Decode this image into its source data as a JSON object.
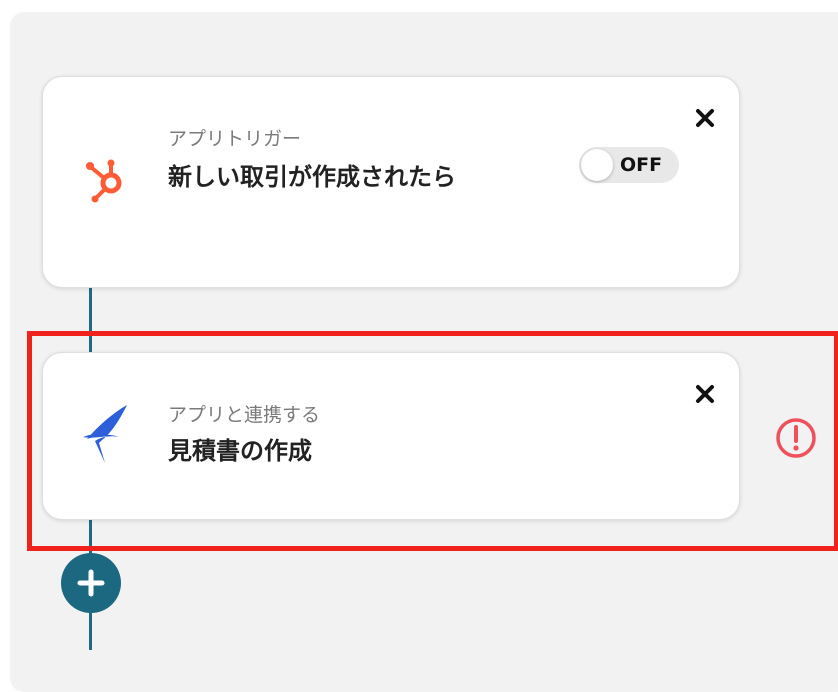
{
  "flow": {
    "trigger": {
      "subtitle": "アプリトリガー",
      "title": "新しい取引が作成されたら",
      "toggle_label": "OFF",
      "app_icon": "hubspot-icon",
      "accent": "#ff5c35"
    },
    "action": {
      "subtitle": "アプリと連携する",
      "title": "見積書の作成",
      "app_icon": "swallow-bird-icon",
      "accent": "#2d5fd8"
    },
    "add_step_icon": "plus-icon",
    "warning_icon": "exclamation-circle-icon",
    "colors": {
      "connector": "#1f6a80",
      "highlight": "#f0221b",
      "warning": "#f0505b"
    }
  }
}
